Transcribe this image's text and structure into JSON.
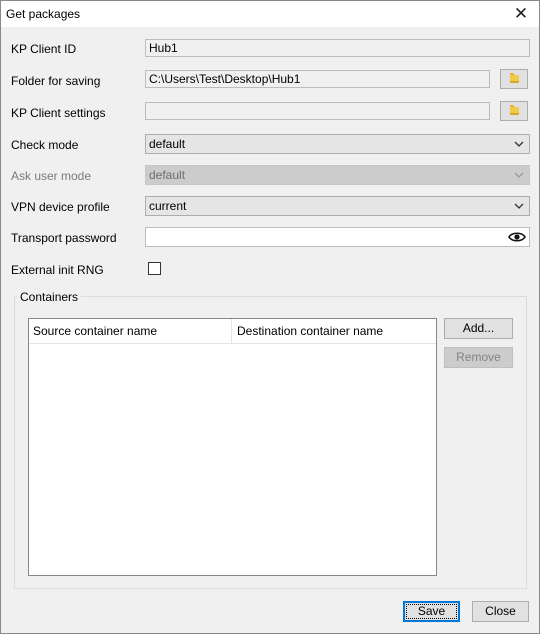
{
  "window": {
    "title": "Get packages",
    "close_label": "✕"
  },
  "form": {
    "kp_client_id": {
      "label": "KP Client ID",
      "value": "Hub1"
    },
    "folder_for_saving": {
      "label": "Folder for saving",
      "value": "C:\\Users\\Test\\Desktop\\Hub1"
    },
    "kp_client_settings": {
      "label": "KP Client settings",
      "value": ""
    },
    "check_mode": {
      "label": "Check mode",
      "value": "default"
    },
    "ask_user_mode": {
      "label": "Ask user mode",
      "value": "default"
    },
    "vpn_device_profile": {
      "label": "VPN device profile",
      "value": "current"
    },
    "transport_password": {
      "label": "Transport password",
      "value": ""
    },
    "external_init_rng": {
      "label": "External init RNG",
      "checked": false
    }
  },
  "containers": {
    "title": "Containers",
    "columns": [
      "Source container name",
      "Destination container name"
    ],
    "rows": [],
    "add_label": "Add...",
    "remove_label": "Remove"
  },
  "footer": {
    "save_label": "Save",
    "close_label": "Close"
  },
  "icons": {
    "browse": "folder-icon",
    "dropdown": "chevron-down-icon",
    "password": "eye-icon",
    "close": "close-icon"
  },
  "colors": {
    "focus_border": "#0078d7",
    "folder": "#f2c94c"
  }
}
